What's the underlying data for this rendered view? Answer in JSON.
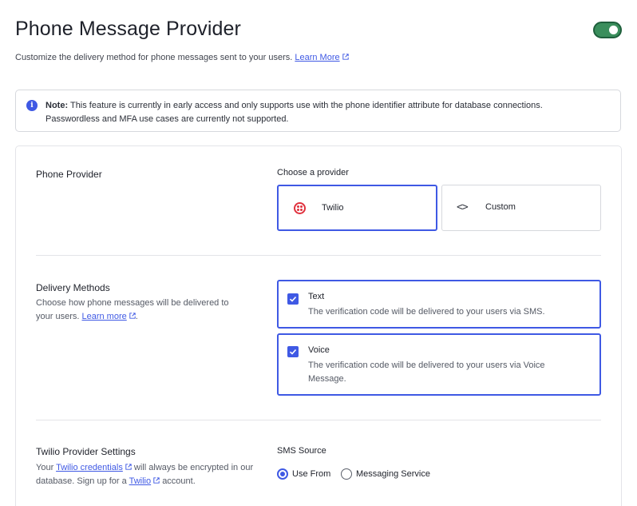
{
  "header": {
    "title": "Phone Message Provider",
    "enabled": true,
    "subtitle": "Customize the delivery method for phone messages sent to your users.",
    "learn_more": "Learn More"
  },
  "note": {
    "label": "Note:",
    "text": "This feature is currently in early access and only supports use with the phone identifier attribute for database connections.",
    "text2": "Passwordless and MFA use cases are currently not supported."
  },
  "provider": {
    "section_label": "Phone Provider",
    "choose_label": "Choose a provider",
    "options": [
      {
        "label": "Twilio",
        "icon": "twilio-icon",
        "selected": true
      },
      {
        "label": "Custom",
        "icon": "code-icon",
        "selected": false
      }
    ]
  },
  "delivery": {
    "section_label": "Delivery Methods",
    "desc": "Choose how phone messages will be delivered to your users.",
    "learn_more": "Learn more",
    "methods": [
      {
        "title": "Text",
        "desc": "The verification code will be delivered to your users via SMS.",
        "checked": true
      },
      {
        "title": "Voice",
        "desc": "The verification code will be delivered to your users via Voice Message.",
        "checked": true
      }
    ]
  },
  "twilio_settings": {
    "section_label": "Twilio Provider Settings",
    "desc_prefix": "Your",
    "credentials_link": "Twilio credentials",
    "desc_middle": "will always be encrypted in our database. Sign up for a",
    "twilio_link": "Twilio",
    "desc_suffix": "account.",
    "sms_source_label": "SMS Source",
    "sms_source_options": [
      {
        "label": "Use From",
        "selected": true
      },
      {
        "label": "Messaging Service",
        "selected": false
      }
    ]
  },
  "colors": {
    "accent": "#3f59e4",
    "toggle_on": "#3a8e5c",
    "twilio_red": "#e0323e"
  }
}
